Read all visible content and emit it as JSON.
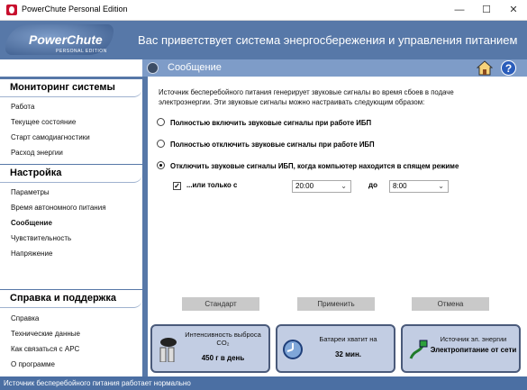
{
  "window": {
    "title": "PowerChute Personal Edition",
    "minimize": "—",
    "maximize": "☐",
    "close": "✕"
  },
  "header": {
    "logo_main": "PowerChute",
    "logo_sub": "PERSONAL EDITION",
    "welcome": "Вас приветствует система энергосбережения и управления питанием"
  },
  "subheader": {
    "title": "Сообщение",
    "help": "?"
  },
  "sidebar": {
    "monitoring": {
      "title": "Мониторинг системы",
      "items": [
        "Работа",
        "Текущее состояние",
        "Старт самодиагностики",
        "Расход энергии"
      ]
    },
    "settings": {
      "title": "Настройка",
      "items": [
        "Параметры",
        "Время автономного питания",
        "Сообщение",
        "Чувствительность",
        "Напряжение"
      ]
    },
    "support": {
      "title": "Справка и поддержка",
      "items": [
        "Справка",
        "Технические данные",
        "Как связаться с APC",
        "О программе"
      ]
    }
  },
  "main": {
    "description": "Источник бесперебойного питания генерирует звуковые сигналы во время сбоев в подаче электроэнергии.  Эти звуковые сигналы можно настраивать следующим образом:",
    "options": [
      {
        "label": "Полностью включить звуковые сигналы при работе ИБП",
        "selected": false
      },
      {
        "label": "Полностью отключить звуковые сигналы при работе ИБП",
        "selected": false
      },
      {
        "label": "Отключить звуковые сигналы ИБП, когда компьютер находится в спящем режиме",
        "selected": true
      }
    ],
    "only_between": {
      "label": "...или только с",
      "checked": true,
      "check_mark": "✓",
      "from": "20:00",
      "to_label": "до",
      "to": "8:00"
    },
    "buttons": {
      "default": "Стандарт",
      "apply": "Применить",
      "cancel": "Отмена"
    }
  },
  "cards": {
    "co2": {
      "label_line1": "Интенсивность выброса",
      "label_line2": "CO₂",
      "value": "450 г в день"
    },
    "battery": {
      "label": "Батареи хватит на",
      "value": "32 мин."
    },
    "power": {
      "label": "Источник эл. энергии",
      "value": "Электропитание от сети"
    }
  },
  "status": {
    "text": "Источник бесперебойного питания работает нормально"
  },
  "colors": {
    "header_bg": "#5778a8",
    "subheader_bg": "#7e9cc8",
    "status_bg": "#4b6fa3",
    "card_bg": "#c2cde3"
  }
}
